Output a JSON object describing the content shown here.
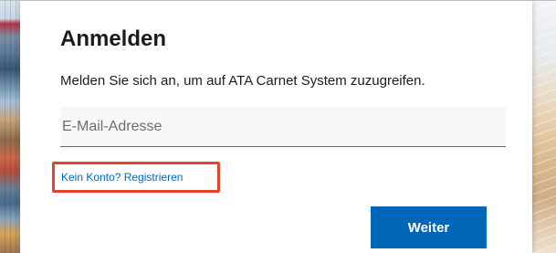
{
  "signin": {
    "title": "Anmelden",
    "description": "Melden Sie sich an, um auf ATA Carnet System zuzugreifen.",
    "email_placeholder": "E-Mail-Adresse",
    "email_value": "",
    "register_link": "Kein Konto? Registrieren",
    "next_button": "Weiter"
  },
  "colors": {
    "accent": "#0067b8",
    "highlight_border": "#e2452c",
    "text": "#1b1b1b"
  }
}
